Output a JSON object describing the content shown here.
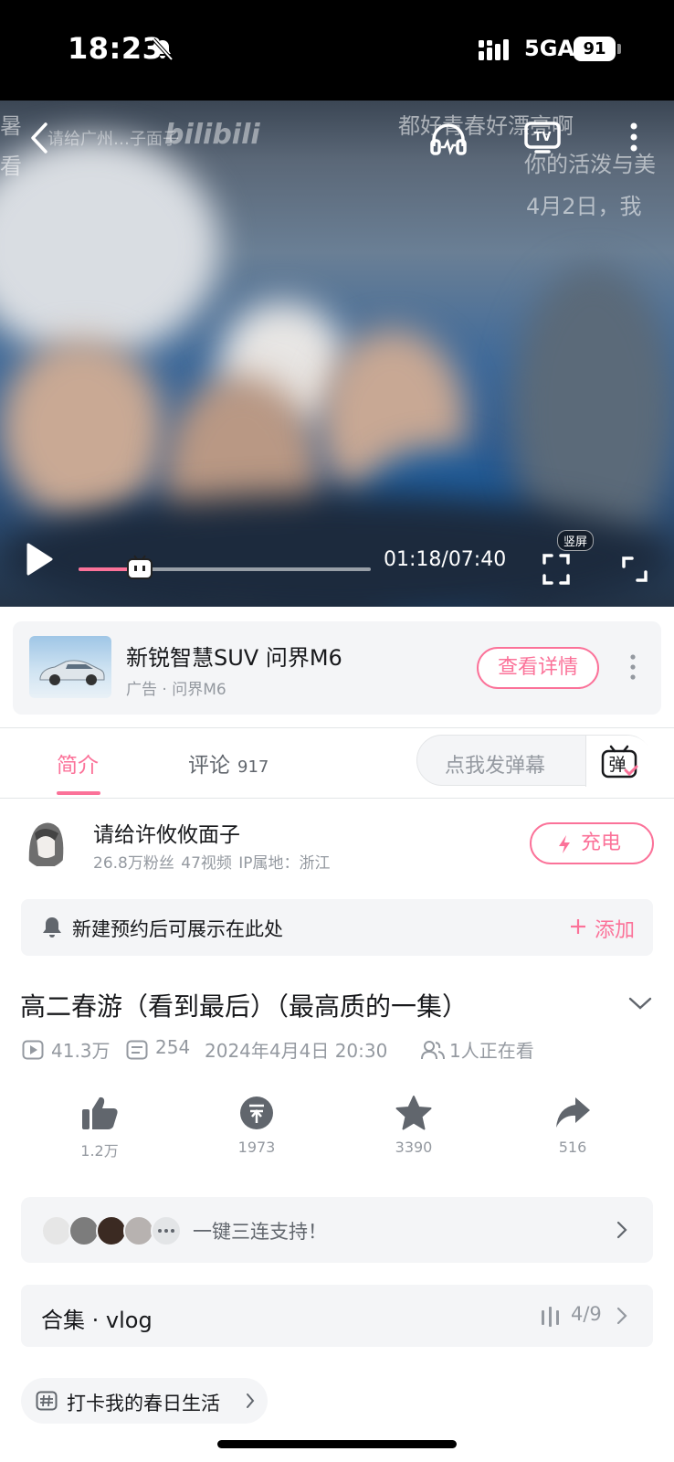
{
  "status_bar": {
    "time": "18:23",
    "network": "5GA",
    "battery": "91"
  },
  "player": {
    "watermark_uploader": "请给广州…子面子",
    "watermark_brand": "bilibili",
    "danmaku": [
      "都好青春好漂亮啊",
      "你的活泼与美",
      "4月2日，我",
      "暑",
      "看"
    ],
    "time_display": "01:18/07:40",
    "progress": 0.169,
    "portrait_badge": "竖屏"
  },
  "ad": {
    "title": "新锐智慧SUV 问界M6",
    "subtitle": "广告 · 问界M6",
    "button": "查看详情"
  },
  "tabs": {
    "intro": "简介",
    "comments": "评论",
    "comments_count": "917",
    "danmu_placeholder": "点我发弹幕",
    "danmu_icon_text": "弹"
  },
  "uploader": {
    "name": "请给许攸攸面子",
    "meta": "26.8万粉丝   47视频   IP属地：浙江",
    "charge": "充电"
  },
  "reservation": {
    "text": "新建预约后可展示在此处",
    "add": "添加"
  },
  "video": {
    "title": "高二春游（看到最后）（最高质的一集）",
    "views": "41.3万",
    "danmaku_count": "254",
    "date": "2024年4月4日 20:30",
    "watching": "1人正在看"
  },
  "actions": {
    "like": "1.2万",
    "coin": "1973",
    "favorite": "3390",
    "share": "516"
  },
  "triple": {
    "text": "一键三连支持！"
  },
  "collection": {
    "title": "合集 · vlog",
    "progress": "4/9"
  },
  "topic": {
    "text": "打卡我的春日生活"
  },
  "colors": {
    "accent": "#fb7299",
    "panel": "#f4f5f7",
    "muted": "#9499a0"
  }
}
